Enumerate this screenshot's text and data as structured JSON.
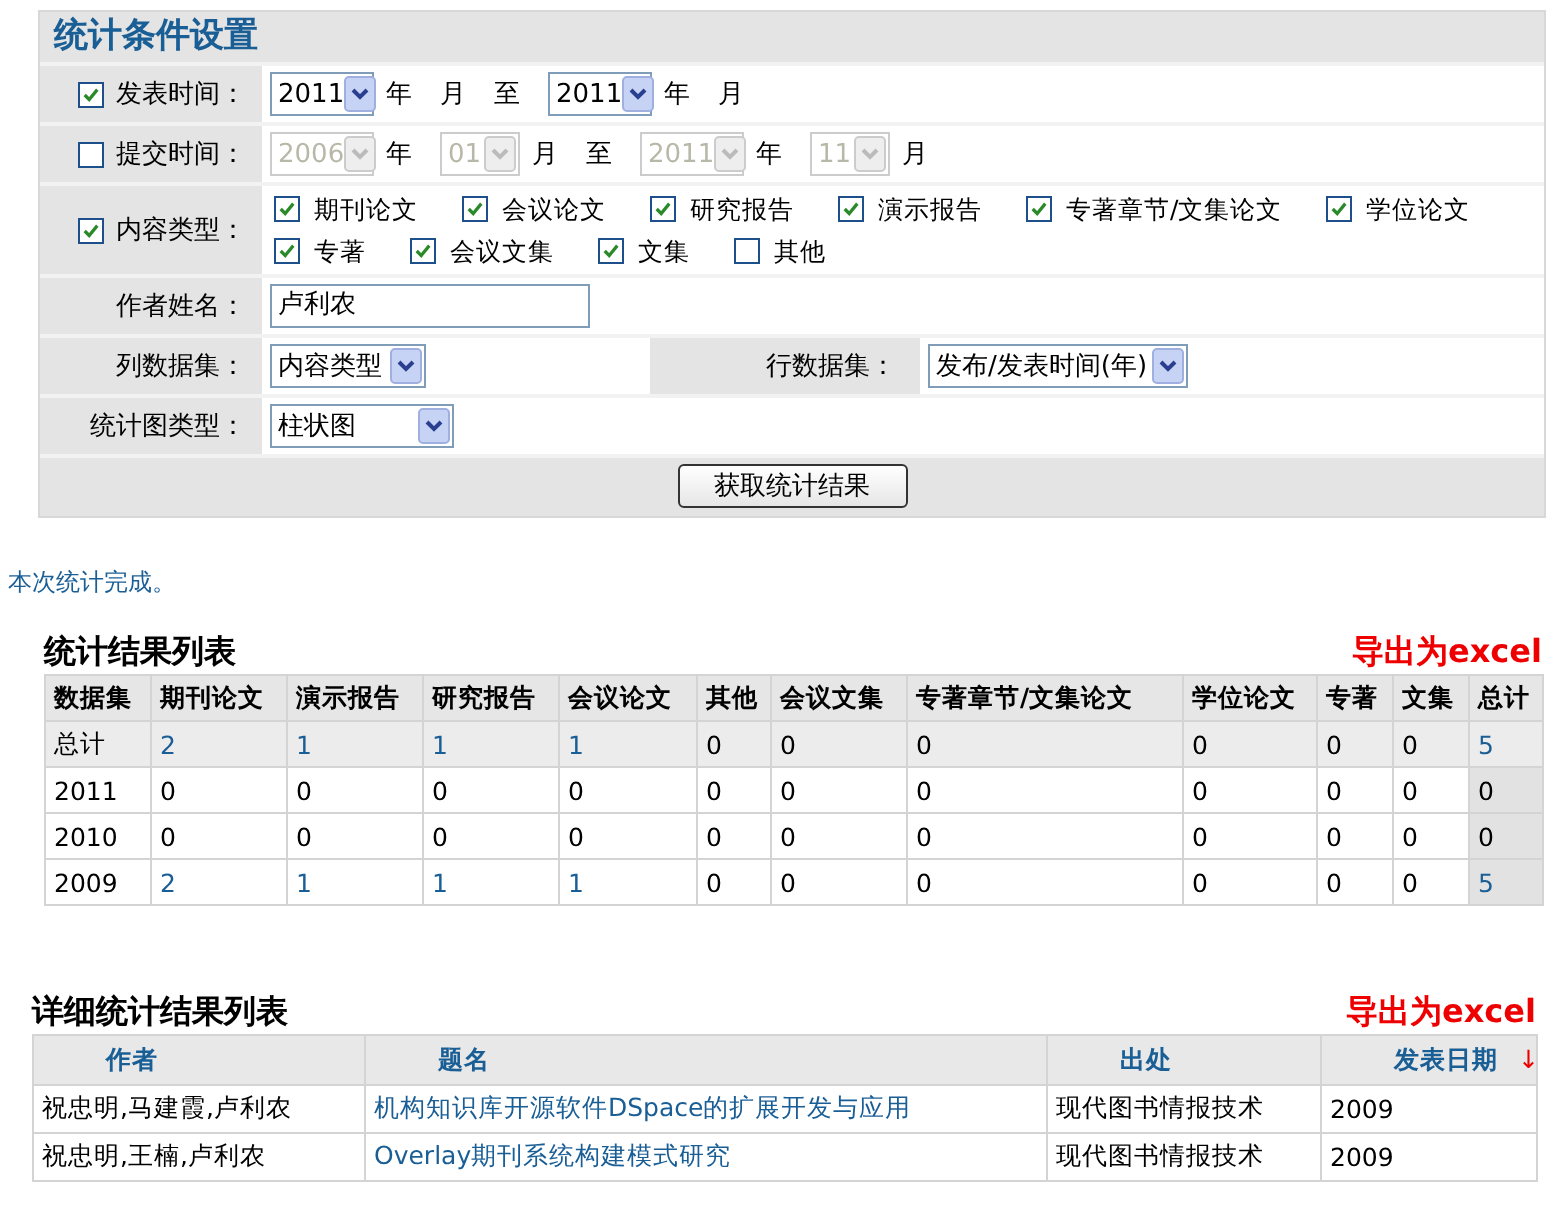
{
  "form": {
    "title": "统计条件设置",
    "date_rows": [
      {
        "label": "发表时间：",
        "checked": true,
        "parts": [
          {
            "kind": "select",
            "value": "2011",
            "disabled": false
          },
          {
            "kind": "text",
            "text": "年"
          },
          {
            "kind": "text",
            "text": "月"
          },
          {
            "kind": "text",
            "text": "至"
          },
          {
            "kind": "select",
            "value": "2011",
            "disabled": false
          },
          {
            "kind": "text",
            "text": "年"
          },
          {
            "kind": "text",
            "text": "月"
          }
        ]
      },
      {
        "label": "提交时间：",
        "checked": false,
        "parts": [
          {
            "kind": "select",
            "value": "2006",
            "disabled": true
          },
          {
            "kind": "text",
            "text": "年"
          },
          {
            "kind": "select",
            "value": "01",
            "disabled": true
          },
          {
            "kind": "text",
            "text": "月"
          },
          {
            "kind": "text",
            "text": "至"
          },
          {
            "kind": "select",
            "value": "2011",
            "disabled": true
          },
          {
            "kind": "text",
            "text": "年"
          },
          {
            "kind": "select",
            "value": "11",
            "disabled": true
          },
          {
            "kind": "text",
            "text": "月"
          }
        ]
      }
    ],
    "content_type": {
      "label": "内容类型：",
      "checked": true,
      "options": [
        {
          "label": "期刊论文",
          "checked": true
        },
        {
          "label": "会议论文",
          "checked": true
        },
        {
          "label": "研究报告",
          "checked": true
        },
        {
          "label": "演示报告",
          "checked": true
        },
        {
          "label": "专著章节/文集论文",
          "checked": true
        },
        {
          "label": "学位论文",
          "checked": true
        },
        {
          "label": "专著",
          "checked": true
        },
        {
          "label": "会议文集",
          "checked": true
        },
        {
          "label": "文集",
          "checked": true
        },
        {
          "label": "其他",
          "checked": false
        }
      ]
    },
    "author": {
      "label": "作者姓名：",
      "value": "卢利农"
    },
    "column_dataset": {
      "label": "列数据集：",
      "value": "内容类型"
    },
    "row_dataset": {
      "label": "行数据集：",
      "value": "发布/发表时间(年)"
    },
    "chart_type": {
      "label": "统计图类型：",
      "value": "柱状图"
    },
    "submit": "获取统计结果"
  },
  "status": "本次统计完成。",
  "summary": {
    "title": "统计结果列表",
    "export": "导出为excel",
    "columns": [
      "数据集",
      "期刊论文",
      "演示报告",
      "研究报告",
      "会议论文",
      "其他",
      "会议文集",
      "专著章节/文集论文",
      "学位论文",
      "专著",
      "文集",
      "总计"
    ],
    "rows": [
      {
        "total": true,
        "cells": [
          {
            "text": "总计",
            "link": false
          },
          {
            "text": "2",
            "link": true
          },
          {
            "text": "1",
            "link": true
          },
          {
            "text": "1",
            "link": true
          },
          {
            "text": "1",
            "link": true
          },
          {
            "text": "0",
            "link": false
          },
          {
            "text": "0",
            "link": false
          },
          {
            "text": "0",
            "link": false
          },
          {
            "text": "0",
            "link": false
          },
          {
            "text": "0",
            "link": false
          },
          {
            "text": "0",
            "link": false
          },
          {
            "text": "5",
            "link": true
          }
        ]
      },
      {
        "total": false,
        "cells": [
          {
            "text": "2011",
            "link": false
          },
          {
            "text": "0",
            "link": false
          },
          {
            "text": "0",
            "link": false
          },
          {
            "text": "0",
            "link": false
          },
          {
            "text": "0",
            "link": false
          },
          {
            "text": "0",
            "link": false
          },
          {
            "text": "0",
            "link": false
          },
          {
            "text": "0",
            "link": false
          },
          {
            "text": "0",
            "link": false
          },
          {
            "text": "0",
            "link": false
          },
          {
            "text": "0",
            "link": false
          },
          {
            "text": "0",
            "link": false
          }
        ]
      },
      {
        "total": false,
        "cells": [
          {
            "text": "2010",
            "link": false
          },
          {
            "text": "0",
            "link": false
          },
          {
            "text": "0",
            "link": false
          },
          {
            "text": "0",
            "link": false
          },
          {
            "text": "0",
            "link": false
          },
          {
            "text": "0",
            "link": false
          },
          {
            "text": "0",
            "link": false
          },
          {
            "text": "0",
            "link": false
          },
          {
            "text": "0",
            "link": false
          },
          {
            "text": "0",
            "link": false
          },
          {
            "text": "0",
            "link": false
          },
          {
            "text": "0",
            "link": false
          }
        ]
      },
      {
        "total": false,
        "cells": [
          {
            "text": "2009",
            "link": false
          },
          {
            "text": "2",
            "link": true
          },
          {
            "text": "1",
            "link": true
          },
          {
            "text": "1",
            "link": true
          },
          {
            "text": "1",
            "link": true
          },
          {
            "text": "0",
            "link": false
          },
          {
            "text": "0",
            "link": false
          },
          {
            "text": "0",
            "link": false
          },
          {
            "text": "0",
            "link": false
          },
          {
            "text": "0",
            "link": false
          },
          {
            "text": "0",
            "link": false
          },
          {
            "text": "5",
            "link": true
          }
        ]
      }
    ]
  },
  "detail": {
    "title": "详细统计结果列表",
    "export": "导出为excel",
    "columns": [
      {
        "label": "作者"
      },
      {
        "label": "题名"
      },
      {
        "label": "出处"
      },
      {
        "label": "发表日期",
        "sort": "↓"
      }
    ],
    "rows": [
      {
        "author": "祝忠明,马建霞,卢利农",
        "title": "机构知识库开源软件DSpace的扩展开发与应用",
        "source": "现代图书情报技术",
        "date": "2009"
      },
      {
        "author": "祝忠明,王楠,卢利农",
        "title": "Overlay期刊系统构建模式研究",
        "source": "现代图书情报技术",
        "date": "2009"
      }
    ]
  }
}
